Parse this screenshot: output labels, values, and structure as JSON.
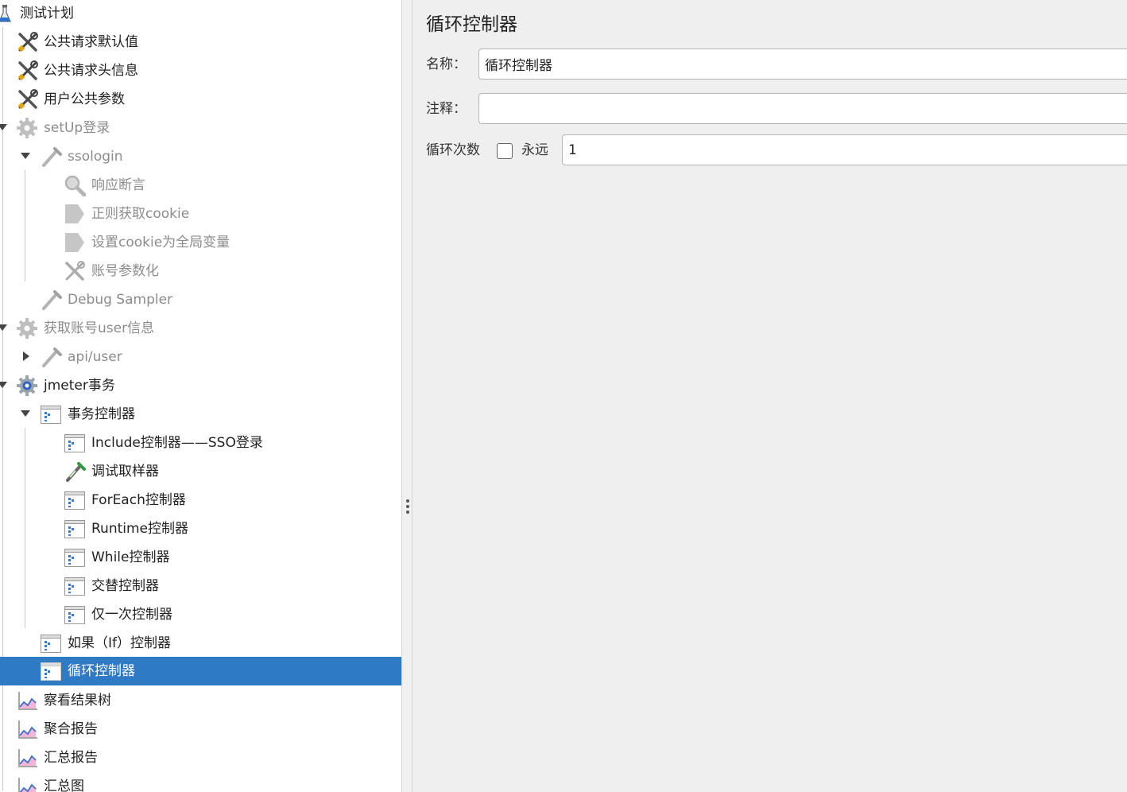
{
  "tree": {
    "items": [
      {
        "label": "测试计划",
        "icon": "test-plan-flask-icon"
      },
      {
        "label": "公共请求默认值",
        "icon": "wrench-screwdriver-icon"
      },
      {
        "label": "公共请求头信息",
        "icon": "wrench-screwdriver-icon"
      },
      {
        "label": "用户公共参数",
        "icon": "wrench-screwdriver-icon"
      },
      {
        "label": "setUp登录",
        "icon": "gear-icon"
      },
      {
        "label": "ssologin",
        "icon": "pipette-sampler-icon"
      },
      {
        "label": "响应断言",
        "icon": "magnifier-icon"
      },
      {
        "label": "正则获取cookie",
        "icon": "post-processor-icon"
      },
      {
        "label": "设置cookie为全局变量",
        "icon": "post-processor-icon"
      },
      {
        "label": "账号参数化",
        "icon": "wrench-screwdriver-icon"
      },
      {
        "label": "Debug Sampler",
        "icon": "pipette-sampler-icon"
      },
      {
        "label": "获取账号user信息",
        "icon": "gear-icon"
      },
      {
        "label": "api/user",
        "icon": "pipette-sampler-icon"
      },
      {
        "label": "jmeter事务",
        "icon": "gear-blue-icon"
      },
      {
        "label": "事务控制器",
        "icon": "controller-icon"
      },
      {
        "label": "Include控制器——SSO登录",
        "icon": "controller-icon"
      },
      {
        "label": "调试取样器",
        "icon": "pipette-green-icon"
      },
      {
        "label": "ForEach控制器",
        "icon": "controller-icon"
      },
      {
        "label": "Runtime控制器",
        "icon": "controller-icon"
      },
      {
        "label": "While控制器",
        "icon": "controller-icon"
      },
      {
        "label": "交替控制器",
        "icon": "controller-icon"
      },
      {
        "label": "仅一次控制器",
        "icon": "controller-icon"
      },
      {
        "label": "如果（If）控制器",
        "icon": "controller-icon"
      },
      {
        "label": "循环控制器",
        "icon": "controller-icon"
      },
      {
        "label": "察看结果树",
        "icon": "graph-listener-icon"
      },
      {
        "label": "聚合报告",
        "icon": "graph-listener-icon"
      },
      {
        "label": "汇总报告",
        "icon": "graph-listener-icon"
      },
      {
        "label": "汇总图",
        "icon": "graph-listener-icon"
      }
    ]
  },
  "panel": {
    "title": "循环控制器",
    "name_label": "名称：",
    "name_value": "循环控制器",
    "comment_label": "注释：",
    "comment_value": "",
    "loop_label": "循环次数",
    "forever_label": "永远",
    "loop_value": "1"
  },
  "colors": {
    "selection": "#2f7ac5",
    "panel_bg": "#efefef",
    "disabled_text": "#8c8c8c"
  }
}
